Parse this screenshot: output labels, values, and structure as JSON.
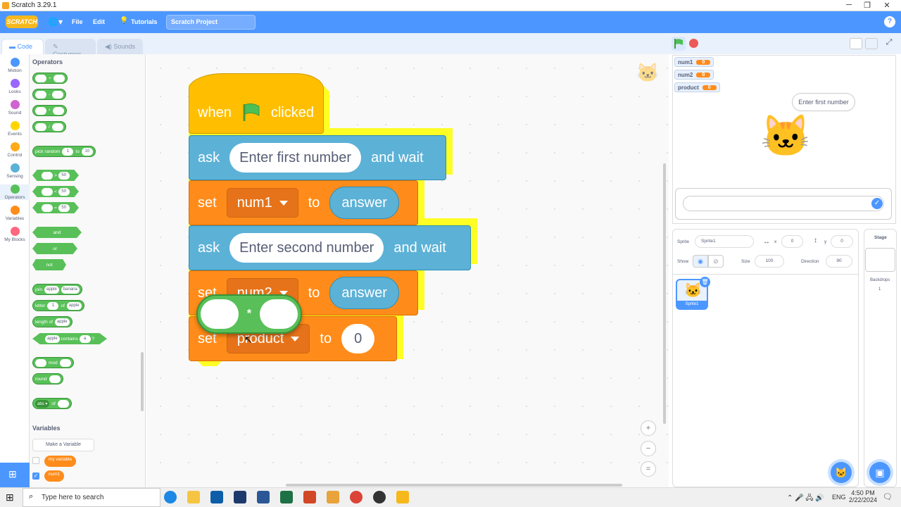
{
  "window": {
    "title": "Scratch 3.29.1",
    "min": "─",
    "max": "❐",
    "close": "✕"
  },
  "menu": {
    "logo": "SCRATCH",
    "file": "File",
    "edit": "Edit",
    "tutorials": "Tutorials",
    "project_title": "Scratch Project",
    "help": "?"
  },
  "tabs": {
    "code": "Code",
    "costumes": "Costumes",
    "sounds": "Sounds"
  },
  "categories": [
    {
      "label": "Motion",
      "color": "#4c97ff"
    },
    {
      "label": "Looks",
      "color": "#9966ff"
    },
    {
      "label": "Sound",
      "color": "#cf63cf"
    },
    {
      "label": "Events",
      "color": "#ffd500"
    },
    {
      "label": "Control",
      "color": "#ffab19"
    },
    {
      "label": "Sensing",
      "color": "#5cb1d6"
    },
    {
      "label": "Operators",
      "color": "#59c059"
    },
    {
      "label": "Variables",
      "color": "#ff8c1a"
    },
    {
      "label": "My Blocks",
      "color": "#ff6680"
    }
  ],
  "palette": {
    "operators_title": "Operators",
    "plus": "+",
    "minus": "-",
    "times": "*",
    "divide": "/",
    "pick_random": "pick random",
    "to": "to",
    "r1": "1",
    "r10": "10",
    "gt": ">",
    "lt": "<",
    "eq": "=",
    "fifty": "50",
    "and": "and",
    "or": "or",
    "not": "not",
    "join": "join",
    "apple": "apple",
    "banana": "banana",
    "letter": "letter",
    "of": "of",
    "one": "1",
    "length_of": "length of",
    "contains": "contains",
    "a": "a",
    "q": "?",
    "mod": "mod",
    "round": "round",
    "abs": "abs ▾",
    "of2": "of",
    "variables_title": "Variables",
    "make_var": "Make a Variable",
    "my_variable": "my variable",
    "num1": "num1"
  },
  "script": {
    "when": "when",
    "clicked": "clicked",
    "ask1": "ask",
    "ask1_text": "Enter first number",
    "and_wait1": "and wait",
    "set1": "set",
    "var1": "num1",
    "to1": "to",
    "answer1": "answer",
    "ask2": "ask",
    "ask2_text": "Enter second number",
    "and_wait2": "and wait",
    "set2": "set",
    "var2": "num2",
    "to2": "to",
    "answer2": "answer",
    "set3": "set",
    "var3": "product",
    "to3": "to",
    "value3": "0",
    "op": "*"
  },
  "monitors": [
    {
      "name": "num1",
      "value": "0"
    },
    {
      "name": "num2",
      "value": "0"
    },
    {
      "name": "product",
      "value": "0"
    }
  ],
  "stage": {
    "speech": "Enter first number"
  },
  "sprite_info": {
    "sprite_label": "Sprite",
    "sprite_name": "Sprite1",
    "x_label": "x",
    "x": "0",
    "y_label": "y",
    "y": "0",
    "show_label": "Show",
    "size_label": "Size",
    "size": "100",
    "direction_label": "Direction",
    "direction": "90"
  },
  "sprites": [
    {
      "name": "Sprite1"
    }
  ],
  "stage_pane": {
    "title": "Stage",
    "backdrops_label": "Backdrops",
    "backdrops_count": "1"
  },
  "taskbar": {
    "search": "Type here to search",
    "lang": "ENG",
    "time": "4:50 PM",
    "date": "2/22/2024"
  }
}
